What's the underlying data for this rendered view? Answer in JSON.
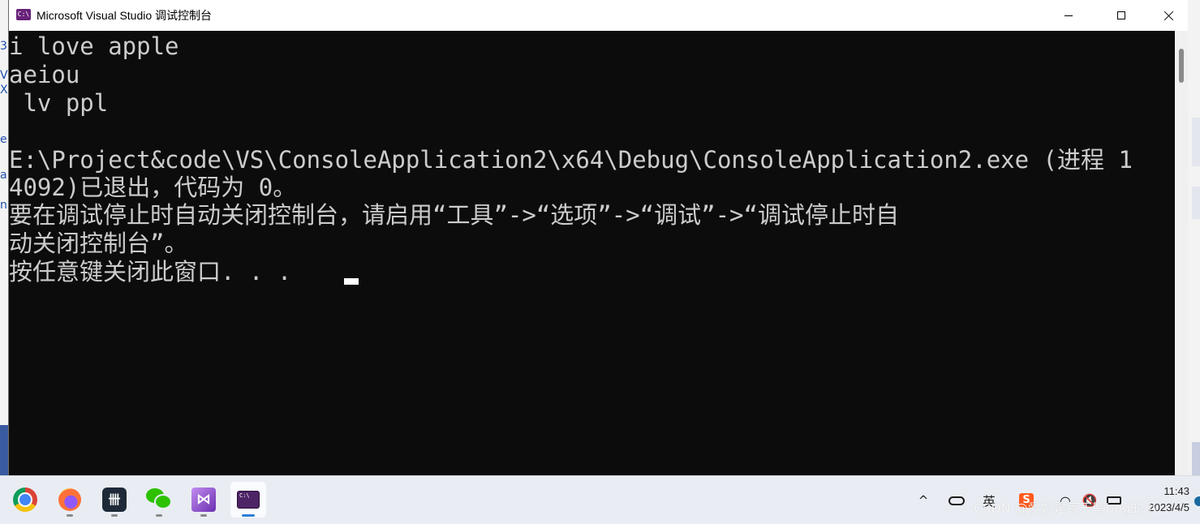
{
  "window": {
    "title": "Microsoft Visual Studio 调试控制台",
    "app_icon_text": "C:\\",
    "minimize_icon": "minimize-icon",
    "maximize_icon": "maximize-icon",
    "close_icon": "close-icon"
  },
  "console": {
    "lines": [
      "i love apple",
      "aeiou",
      " lv ppl",
      "",
      "E:\\Project&code\\VS\\ConsoleApplication2\\x64\\Debug\\ConsoleApplication2.exe (进程 1",
      "4092)已退出，代码为 0。",
      "要在调试停止时自动关闭控制台，请启用“工具”->“选项”->“调试”->“调试停止时自",
      "动关闭控制台”。",
      "按任意键关闭此窗口. . ."
    ],
    "text_color": "#cccccc",
    "background_color": "#0c0c0c"
  },
  "background_fragments": [
    "3",
    "V",
    "X",
    "e",
    "a",
    "n"
  ],
  "taskbar": {
    "apps": [
      {
        "name": "chrome-icon",
        "active": false
      },
      {
        "name": "firefox-icon",
        "active": false
      },
      {
        "name": "dev-app-icon",
        "label": "卌",
        "active": false
      },
      {
        "name": "wechat-icon",
        "active": false
      },
      {
        "name": "visual-studio-icon",
        "label": "⋈",
        "active": false
      },
      {
        "name": "console-app-icon",
        "label": "C:\\",
        "active": true
      }
    ],
    "tray": {
      "chevron": "^",
      "ime": "英",
      "s_badge": "S",
      "wifi": "◠",
      "volume": "🔇"
    },
    "clock": {
      "time": "11:43",
      "date": "2023/4/5"
    },
    "watermark": "CSDN @爱好是每天写bug的小"
  },
  "colors": {
    "accent": "#2b7fd6",
    "vs_purple": "#68217a"
  }
}
